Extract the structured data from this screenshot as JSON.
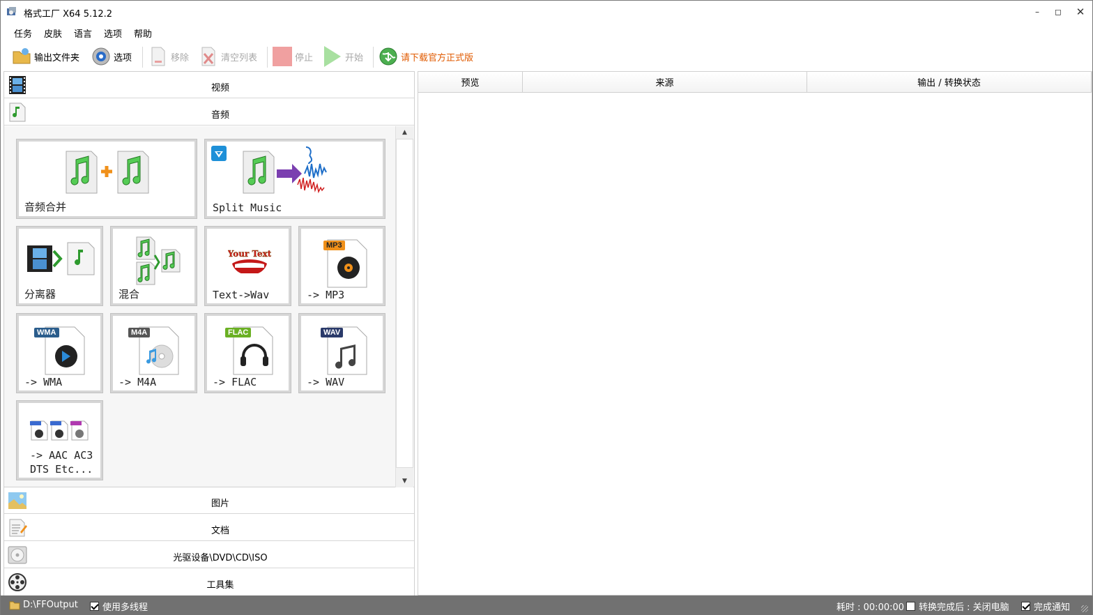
{
  "window": {
    "title": "格式工厂 X64 5.12.2"
  },
  "menu": [
    "任务",
    "皮肤",
    "语言",
    "选项",
    "帮助"
  ],
  "toolbar": {
    "output_folder": "输出文件夹",
    "options": "选项",
    "remove": "移除",
    "clear_list": "清空列表",
    "stop": "停止",
    "start": "开始",
    "download": "请下载官方正式版"
  },
  "categories": {
    "video": "视频",
    "audio": "音频",
    "image": "图片",
    "document": "文档",
    "disc": "光驱设备\\DVD\\CD\\ISO",
    "tools": "工具集"
  },
  "tiles": {
    "merge": "音频合并",
    "split": "Split Music",
    "splitter": "分离器",
    "mix": "混合",
    "text_wav": "Text->Wav",
    "mp3": "-> MP3",
    "wma": "-> WMA",
    "m4a": "-> M4A",
    "flac": "-> FLAC",
    "wav": "-> WAV",
    "aac_1": "-> AAC AC3",
    "aac_2": "DTS Etc...",
    "badge_mp3": "MP3",
    "badge_wma": "WMA",
    "badge_m4a": "M4A",
    "badge_flac": "FLAC",
    "badge_wav": "WAV",
    "your_text": "Your Text"
  },
  "table": {
    "columns": [
      "预览",
      "来源",
      "输出 / 转换状态"
    ]
  },
  "status": {
    "path": "D:\\FFOutput",
    "multithread": "使用多线程",
    "elapsed": "耗时 : 00:00:00",
    "after_convert": "转换完成后 : 关闭电脑",
    "notify": "完成通知"
  },
  "colors": {
    "accent_orange": "#e05a00",
    "statusbar": "#717171",
    "badge_mp3": "#f0901a",
    "badge_wma": "#2b5d8c",
    "badge_m4a": "#555555",
    "badge_flac": "#6ab023",
    "badge_wav": "#2a3a6a"
  }
}
